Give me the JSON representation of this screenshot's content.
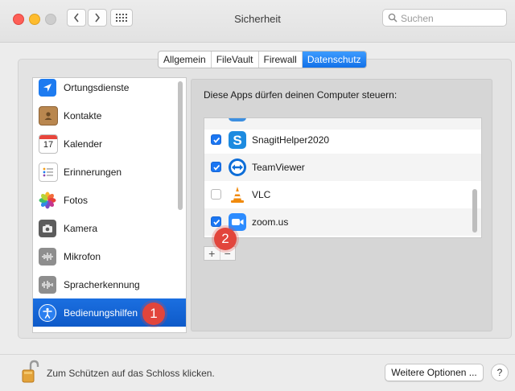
{
  "window": {
    "title": "Sicherheit"
  },
  "toolbar": {
    "back_icon": "chevron-left-icon",
    "forward_icon": "chevron-right-icon",
    "grid_icon": "show-all-grid-icon",
    "search_placeholder": "Suchen"
  },
  "tabs": [
    {
      "label": "Allgemein",
      "active": false
    },
    {
      "label": "FileVault",
      "active": false
    },
    {
      "label": "Firewall",
      "active": false
    },
    {
      "label": "Datenschutz",
      "active": true
    }
  ],
  "sidebar": {
    "items": [
      {
        "label": "Ortungsdienste",
        "icon": "location-arrow-icon",
        "selected": false
      },
      {
        "label": "Kontakte",
        "icon": "contacts-book-icon",
        "selected": false
      },
      {
        "label": "Kalender",
        "icon": "calendar-icon",
        "day": "17",
        "selected": false
      },
      {
        "label": "Erinnerungen",
        "icon": "reminders-icon",
        "selected": false
      },
      {
        "label": "Fotos",
        "icon": "photos-flower-icon",
        "selected": false
      },
      {
        "label": "Kamera",
        "icon": "camera-icon",
        "selected": false
      },
      {
        "label": "Mikrofon",
        "icon": "microphone-waveform-icon",
        "selected": false
      },
      {
        "label": "Spracherkennung",
        "icon": "speech-waveform-icon",
        "selected": false
      },
      {
        "label": "Bedienungshilfen",
        "icon": "accessibility-icon",
        "selected": true
      }
    ]
  },
  "panel": {
    "title": "Diese Apps dürfen deinen Computer steuern:",
    "apps": [
      {
        "label": "SnagitHelper2020",
        "checked": true,
        "icon": "snagit-icon"
      },
      {
        "label": "TeamViewer",
        "checked": true,
        "icon": "teamviewer-icon"
      },
      {
        "label": "VLC",
        "checked": false,
        "icon": "vlc-cone-icon"
      },
      {
        "label": "zoom.us",
        "checked": true,
        "icon": "zoom-camera-icon"
      }
    ],
    "add_label": "+",
    "remove_label": "−"
  },
  "annotations": {
    "badge1": "1",
    "badge2": "2"
  },
  "bottom": {
    "lock_text": "Zum Schützen auf das Schloss klicken.",
    "more_button": "Weitere Optionen ...",
    "help_button": "?"
  },
  "colors": {
    "accent": "#1b6fe0",
    "badge": "#e2453c",
    "checkbox": "#1b76f2"
  }
}
